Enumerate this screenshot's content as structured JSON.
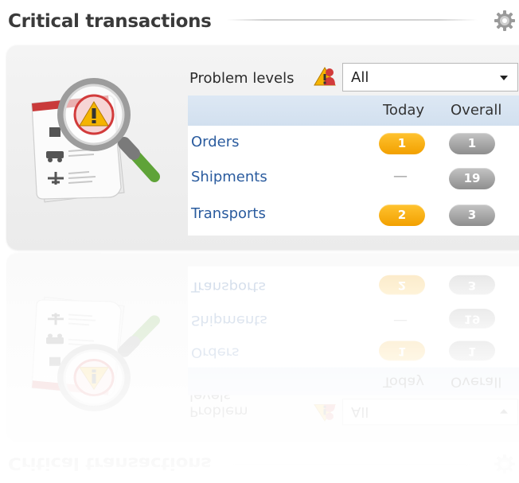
{
  "widget": {
    "title": "Critical transactions",
    "settings_icon": "gear-icon",
    "illustration_icon": "document-magnifier-warning-icon"
  },
  "filter": {
    "label": "Problem levels",
    "icon": "warning-person-icon",
    "selected": "All"
  },
  "table": {
    "columns": [
      "Today",
      "Overall"
    ],
    "rows": [
      {
        "label": "Orders",
        "today": "1",
        "overall": "1"
      },
      {
        "label": "Shipments",
        "today": "—",
        "overall": "19"
      },
      {
        "label": "Transports",
        "today": "2",
        "overall": "3"
      }
    ]
  },
  "colors": {
    "link": "#2a5b9e",
    "today_badge": "#f5a800",
    "overall_badge": "#9a9a9a",
    "header_bg": "#d6e3f1"
  }
}
